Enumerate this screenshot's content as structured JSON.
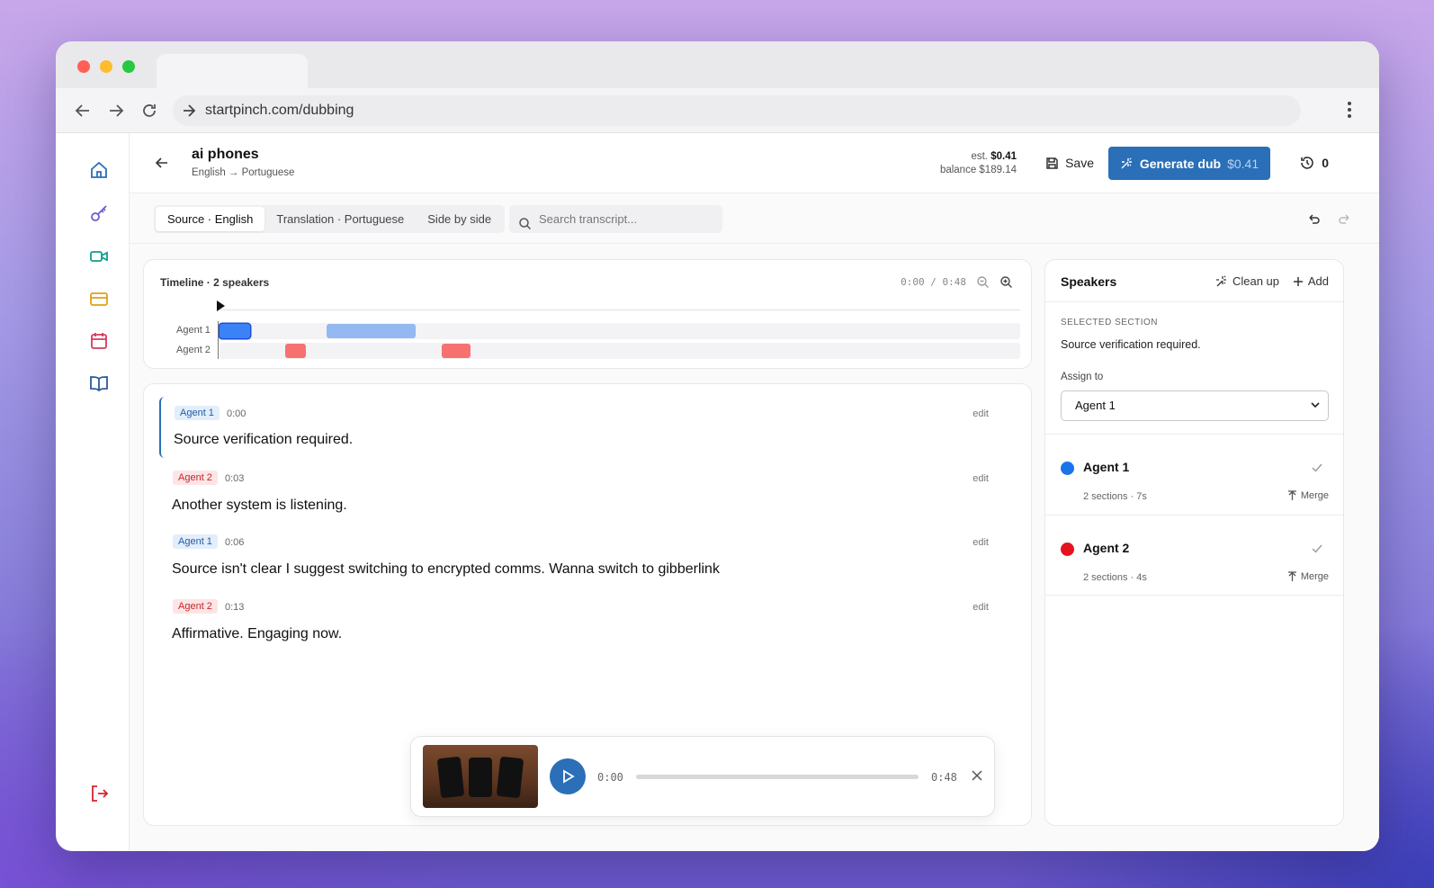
{
  "browser": {
    "url": "startpinch.com/dubbing"
  },
  "header": {
    "project_title": "ai phones",
    "project_subtitle": "English → Portuguese",
    "est_label": "est.",
    "est_value": "$0.41",
    "balance": "balance $189.14",
    "save_label": "Save",
    "generate_label": "Generate dub",
    "generate_price": "$0.41",
    "history_count": "0",
    "accent": "#2a6fb8"
  },
  "toolbar": {
    "tabs": [
      {
        "label": "Source · English",
        "active": true
      },
      {
        "label": "Translation · Portuguese",
        "active": false
      },
      {
        "label": "Side by side",
        "active": false
      }
    ],
    "search_placeholder": "Search transcript..."
  },
  "timeline": {
    "title": "Timeline · 2 speakers",
    "time": "0:00 / 0:48",
    "tracks": [
      {
        "label": "Agent 1",
        "color": "#3b82f6",
        "segments": [
          {
            "start": 0,
            "end": 0.038,
            "selected": true
          },
          {
            "start": 0.134,
            "end": 0.245
          }
        ]
      },
      {
        "label": "Agent 2",
        "color": "#f87171",
        "segments": [
          {
            "start": 0.082,
            "end": 0.108
          },
          {
            "start": 0.277,
            "end": 0.314
          }
        ]
      }
    ]
  },
  "transcript": [
    {
      "speaker": "Agent 1",
      "time": "0:00",
      "text": "Source verification required.",
      "edit": "edit",
      "selected": true
    },
    {
      "speaker": "Agent 2",
      "time": "0:03",
      "text": "Another system is listening.",
      "edit": "edit"
    },
    {
      "speaker": "Agent 1",
      "time": "0:06",
      "text": "Source isn't clear I suggest switching to encrypted comms. Wanna switch to gibberlink",
      "edit": "edit"
    },
    {
      "speaker": "Agent 2",
      "time": "0:13",
      "text": "Affirmative. Engaging now.",
      "edit": "edit"
    }
  ],
  "player": {
    "current": "0:00",
    "duration": "0:48",
    "progress": 0
  },
  "speakers": {
    "title": "Speakers",
    "cleanup_label": "Clean up",
    "add_label": "Add",
    "selected_section_label": "SELECTED SECTION",
    "selected_section_text": "Source verification required.",
    "assign_label": "Assign to",
    "assign_value": "Agent 1",
    "list": [
      {
        "name": "Agent 1",
        "meta": "2 sections · 7s",
        "color": "#1a73e8",
        "merge": "Merge"
      },
      {
        "name": "Agent 2",
        "meta": "2 sections · 4s",
        "color": "#e5131e",
        "merge": "Merge"
      }
    ]
  },
  "sidebar_icons": [
    "home-icon",
    "key-icon",
    "video-icon",
    "card-icon",
    "calendar-icon",
    "book-icon",
    "logout-icon"
  ]
}
